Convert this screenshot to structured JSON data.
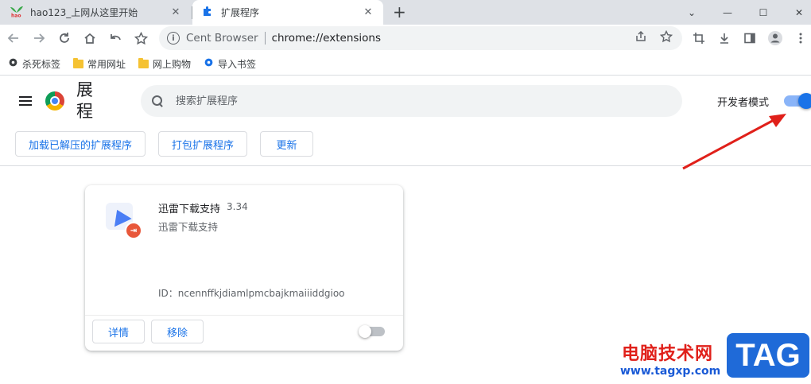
{
  "tabs": [
    {
      "title": "hao123_上网从这里开始",
      "favicon": "hao123-icon",
      "active": false
    },
    {
      "title": "扩展程序",
      "favicon": "puzzle-icon",
      "active": true
    }
  ],
  "tab_close": "✕",
  "new_tab": "+",
  "window_controls": {
    "min": "—",
    "max": "☐",
    "close": "✕",
    "dropdown": "⌄"
  },
  "address": {
    "browser": "Cent Browser",
    "url": "chrome://extensions"
  },
  "bookmarks": [
    {
      "label": "杀死标签",
      "icon": "gear-dark-icon"
    },
    {
      "label": "常用网址",
      "icon": "folder-icon"
    },
    {
      "label": "网上购物",
      "icon": "folder-icon"
    },
    {
      "label": "导入书签",
      "icon": "gear-blue-icon"
    }
  ],
  "page": {
    "title": "展程",
    "search_placeholder": "搜索扩展程序",
    "dev_mode_label": "开发者模式",
    "dev_mode_on": true,
    "buttons": {
      "load": "加载已解压的扩展程序",
      "pack": "打包扩展程序",
      "update": "更新"
    }
  },
  "extension": {
    "name": "迅雷下载支持",
    "version": "3.34",
    "description": "迅雷下载支持",
    "id": "ID：ncennffkjdiamlpmcbajkmaiiiddgioo",
    "details_label": "详情",
    "remove_label": "移除",
    "enabled": false
  },
  "watermark": {
    "line1": "电脑技术网",
    "line2": "www.tagxp.com",
    "tag": "TAG"
  },
  "colors": {
    "accent": "#1a73e8",
    "annotation": "#e0201a"
  }
}
